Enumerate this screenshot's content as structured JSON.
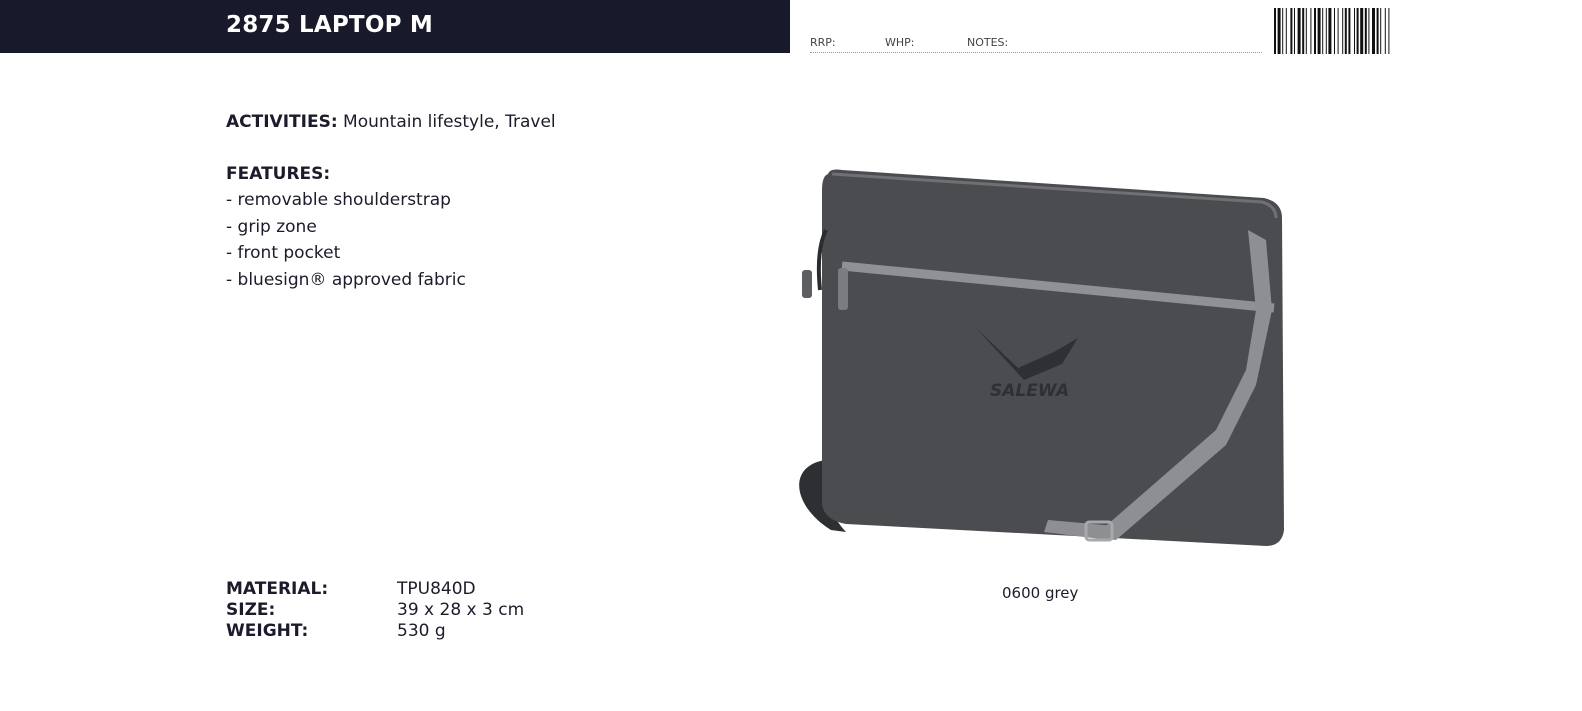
{
  "header": {
    "title": "2875 LAPTOP M",
    "rrp_label": "RRP:",
    "whp_label": "WHP:",
    "notes_label": "NOTES:"
  },
  "activities": {
    "label": "ACTIVITIES:",
    "value": "Mountain lifestyle, Travel"
  },
  "features": {
    "heading": "FEATURES:",
    "items": [
      "- removable shoulderstrap",
      "- grip zone",
      "- front pocket",
      "- bluesign® approved fabric"
    ]
  },
  "specs": [
    {
      "label": "MATERIAL:",
      "value": "TPU840D"
    },
    {
      "label": "SIZE:",
      "value": "39 x 28 x 3 cm"
    },
    {
      "label": "WEIGHT:",
      "value": "530 g"
    }
  ],
  "product": {
    "logo_text": "SALEWA",
    "color_caption": "0600 grey"
  },
  "colors": {
    "header_bg": "#181a2c",
    "bag_body": "#4a4c50",
    "strap": "#8d8f92"
  }
}
